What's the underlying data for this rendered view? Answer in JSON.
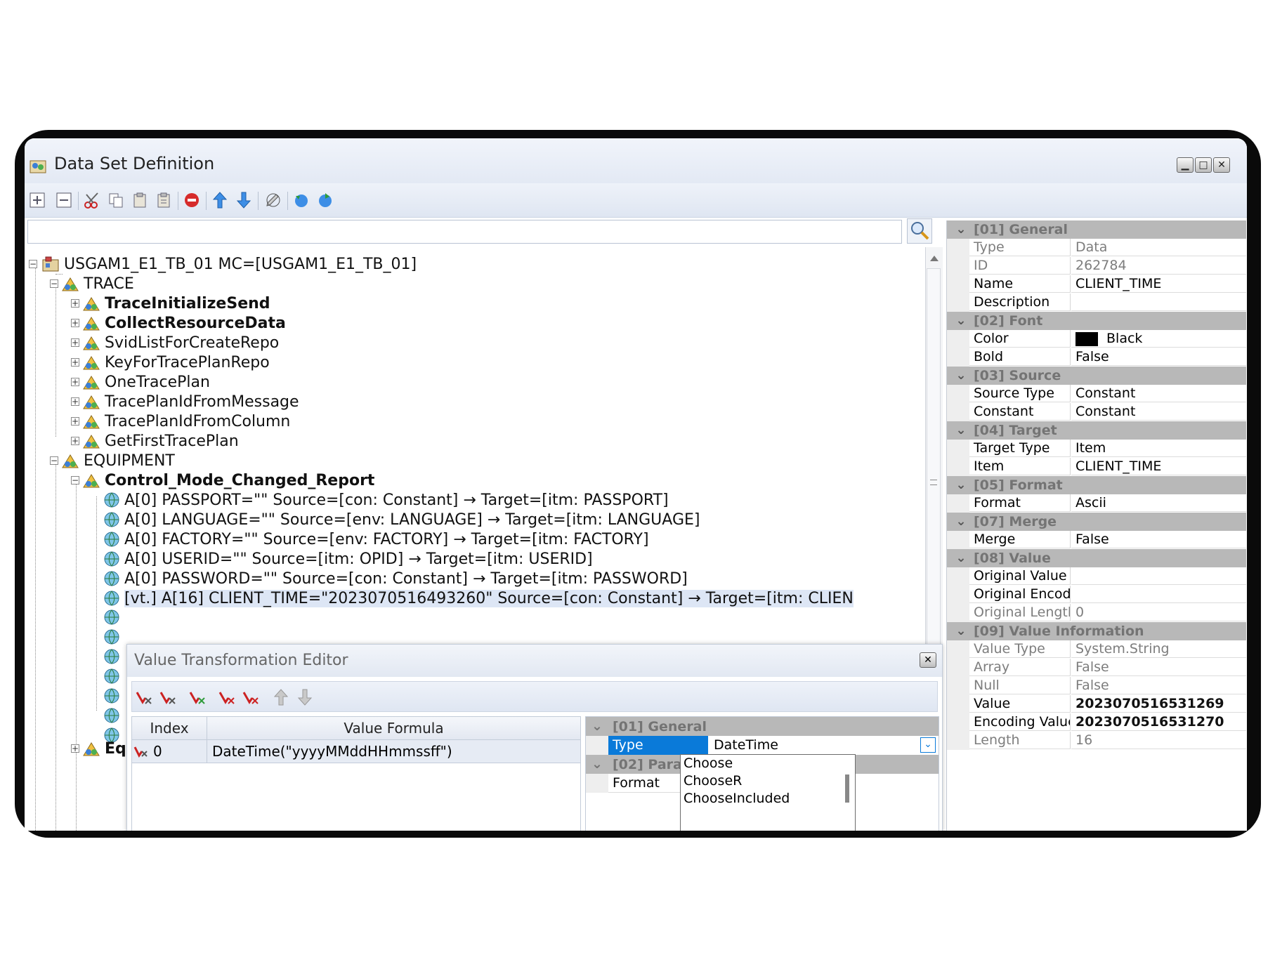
{
  "window": {
    "title": "Data Set Definition"
  },
  "search": {
    "placeholder": "",
    "value": ""
  },
  "tree": {
    "root": "USGAM1_E1_TB_01 MC=[USGAM1_E1_TB_01]",
    "trace": {
      "label": "TRACE",
      "children": [
        {
          "label": "TraceInitializeSend",
          "bold": true
        },
        {
          "label": "CollectResourceData",
          "bold": true
        },
        {
          "label": "SvidListForCreateRepo",
          "bold": false
        },
        {
          "label": "KeyForTracePlanRepo",
          "bold": false
        },
        {
          "label": "OneTracePlan",
          "bold": false
        },
        {
          "label": "TracePlanIdFromMessage",
          "bold": false
        },
        {
          "label": "TracePlanIdFromColumn",
          "bold": false
        },
        {
          "label": "GetFirstTracePlan",
          "bold": false
        }
      ]
    },
    "equipment": {
      "label": "EQUIPMENT",
      "report": {
        "label": "Control_Mode_Changed_Report",
        "items": [
          "A[0] PASSPORT=\"\"  Source=[con: Constant] → Target=[itm: PASSPORT]",
          "A[0] LANGUAGE=\"\"  Source=[env: LANGUAGE] → Target=[itm: LANGUAGE]",
          "A[0]  FACTORY=\"\"  Source=[env:  FACTORY] → Target=[itm: FACTORY]",
          "A[0] USERID=\"\"  Source=[itm: OPID] → Target=[itm: USERID]",
          "A[0] PASSWORD=\"\"  Source=[con: Constant] → Target=[itm: PASSWORD]",
          "[vt.] A[16] CLIENT_TIME=\"2023070516493260\" Source=[con: Constant] → Target=[itm: CLIEN"
        ]
      },
      "last_partial": "Eq"
    }
  },
  "properties": [
    {
      "kind": "cat",
      "label": "[01] General"
    },
    {
      "kind": "row",
      "name": "Type",
      "value": "Data",
      "readonly": true
    },
    {
      "kind": "row",
      "name": "ID",
      "value": "262784",
      "readonly": true
    },
    {
      "kind": "row",
      "name": "Name",
      "value": "CLIENT_TIME"
    },
    {
      "kind": "row",
      "name": "Description",
      "value": ""
    },
    {
      "kind": "cat",
      "label": "[02] Font"
    },
    {
      "kind": "row",
      "name": "Color",
      "value": "Black",
      "swatch": "#000000"
    },
    {
      "kind": "row",
      "name": "Bold",
      "value": "False"
    },
    {
      "kind": "cat",
      "label": "[03] Source"
    },
    {
      "kind": "row",
      "name": "Source Type",
      "value": "Constant"
    },
    {
      "kind": "row",
      "name": "Constant",
      "value": "Constant"
    },
    {
      "kind": "cat",
      "label": "[04] Target"
    },
    {
      "kind": "row",
      "name": "Target Type",
      "value": "Item"
    },
    {
      "kind": "row",
      "name": "Item",
      "value": "CLIENT_TIME"
    },
    {
      "kind": "cat",
      "label": "[05] Format"
    },
    {
      "kind": "row",
      "name": "Format",
      "value": "Ascii"
    },
    {
      "kind": "cat",
      "label": "[07] Merge"
    },
    {
      "kind": "row",
      "name": "Merge",
      "value": "False"
    },
    {
      "kind": "cat",
      "label": "[08] Value"
    },
    {
      "kind": "row",
      "name": "Original Value",
      "value": ""
    },
    {
      "kind": "row",
      "name": "Original Encodir",
      "value": ""
    },
    {
      "kind": "row",
      "name": "Original Length",
      "value": "0",
      "readonly": true
    },
    {
      "kind": "cat",
      "label": "[09] Value Information"
    },
    {
      "kind": "row",
      "name": "Value Type",
      "value": "System.String",
      "readonly": true
    },
    {
      "kind": "row",
      "name": "Array",
      "value": "False",
      "readonly": true
    },
    {
      "kind": "row",
      "name": "Null",
      "value": "False",
      "readonly": true
    },
    {
      "kind": "row",
      "name": "Value",
      "value": "2023070516531269",
      "boldvalue": true
    },
    {
      "kind": "row",
      "name": "Encoding Value",
      "value": "2023070516531270",
      "boldvalue": true
    },
    {
      "kind": "row",
      "name": "Length",
      "value": "16",
      "readonly": true
    }
  ],
  "editor": {
    "title": "Value Transformation Editor",
    "grid": {
      "headers": [
        "Index",
        "Value Formula"
      ],
      "rows": [
        {
          "index": "0",
          "formula": "DateTime(\"yyyyMMddHHmmssff\")"
        }
      ]
    },
    "props": {
      "general": "[01] General",
      "type_name": "Type",
      "type_value": "DateTime",
      "params_partial": "[02] Para",
      "format_name": "Format"
    },
    "dropdown": [
      "Choose",
      "ChooseR",
      "ChooseIncluded"
    ]
  },
  "colors": {
    "accent": "#0a7ad9",
    "category": "#b8b8b8",
    "selection": "#dde6f5"
  }
}
